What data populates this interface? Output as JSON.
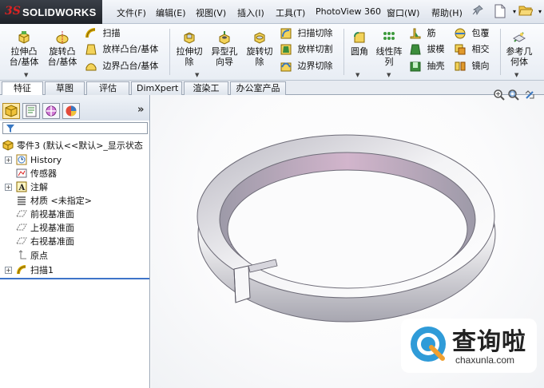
{
  "app": {
    "logo_mark": "3S",
    "logo_word": "SOLIDWORKS"
  },
  "menu": {
    "items": [
      "文件(F)",
      "编辑(E)",
      "视图(V)",
      "插入(I)",
      "工具(T)",
      "PhotoView 360",
      "窗口(W)",
      "帮助(H)"
    ]
  },
  "ribbon": {
    "extrude_boss": "拉伸凸\n台/基体",
    "revolve_boss": "旋转凸\n台/基体",
    "sweep": "扫描",
    "loft_boss": "放样凸台/基体",
    "boundary_boss": "边界凸台/基体",
    "extrude_cut": "拉伸切\n除",
    "hole_wizard": "异型孔\n向导",
    "revolve_cut": "旋转切\n除",
    "sweep_cut": "扫描切除",
    "loft_cut": "放样切割",
    "boundary_cut": "边界切除",
    "fillet": "圆角",
    "linear_pattern": "线性阵\n列",
    "rib": "筋",
    "draft": "拔模",
    "shell": "抽壳",
    "wrap": "包覆",
    "intersect": "相交",
    "mirror": "镜向",
    "reference_geometry": "参考几\n何体"
  },
  "tabs": [
    "特征",
    "草图",
    "评估",
    "DimXpert",
    "渲染工具",
    "办公室产品"
  ],
  "tree": {
    "root": "零件3 (默认<<默认>_显示状态",
    "items": [
      "History",
      "传感器",
      "注解",
      "材质 <未指定>",
      "前视基准面",
      "上视基准面",
      "右视基准面",
      "原点",
      "扫描1"
    ]
  },
  "panel": {
    "more": "»"
  },
  "watermark": {
    "title": "查询啦",
    "domain": "chaxunla.com"
  },
  "colors": {
    "accent": "#3e74c9",
    "ring_light": "#f2f2f2",
    "ring_shadow": "#9a98a8",
    "ring_pink": "#c8a6c0"
  }
}
